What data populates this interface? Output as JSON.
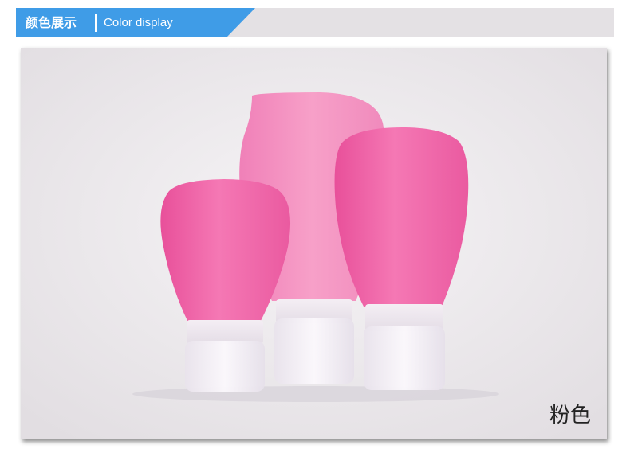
{
  "header": {
    "title_cn": "颜色展示",
    "title_en": "Color display",
    "accent_color": "#3f9ce7",
    "bar_color": "#e4e1e4"
  },
  "photo": {
    "caption": "粉色",
    "product_color": "#f06aa8",
    "background_color": "#ece9ec"
  }
}
